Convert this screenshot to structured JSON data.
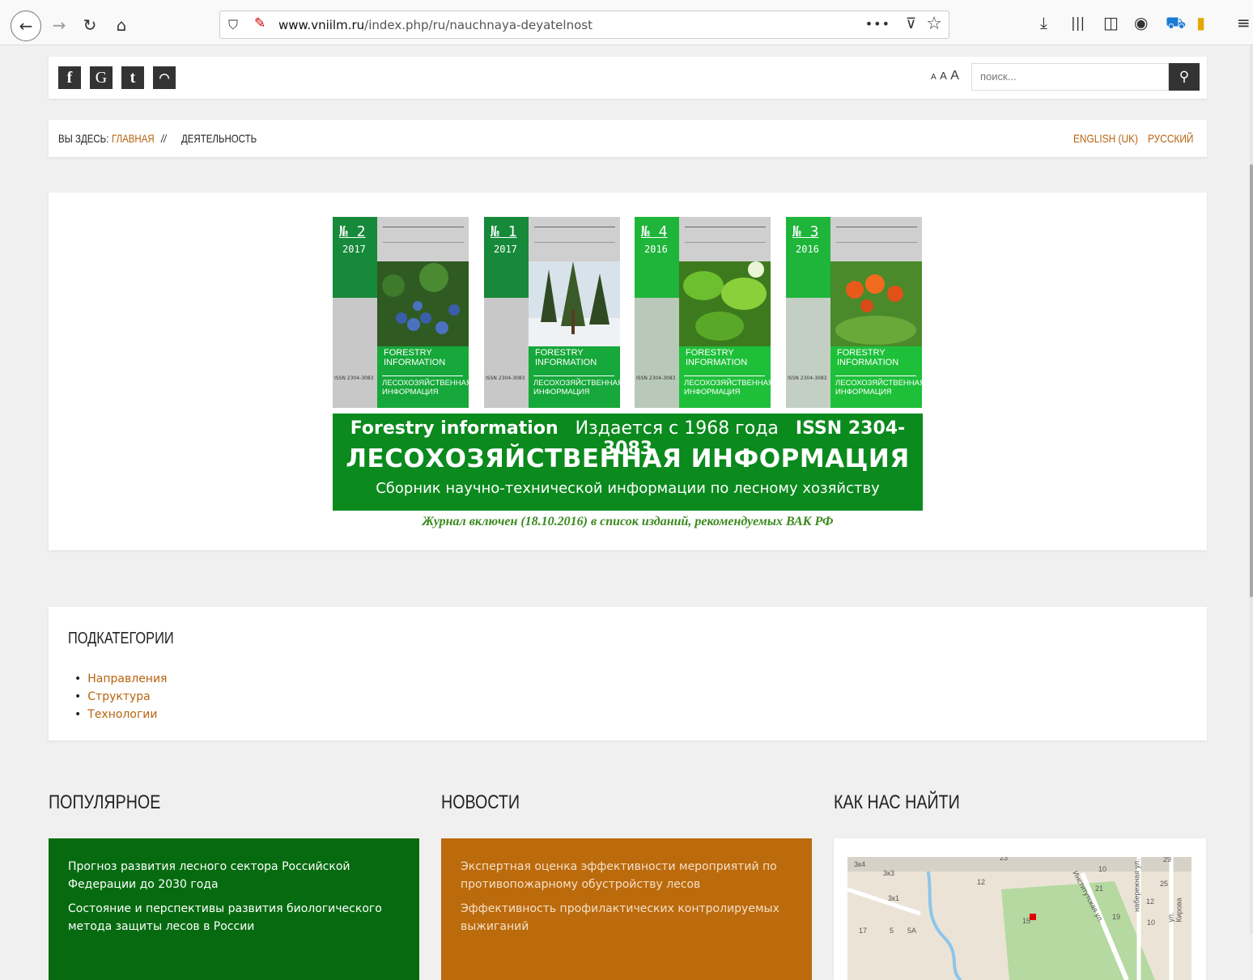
{
  "browser": {
    "url_host": "www.vniilm.ru",
    "url_path": "/index.php/ru/nauchnaya-deyatelnost",
    "menu_dots": "•••"
  },
  "topbar": {
    "social": [
      "f",
      "G",
      "t",
      "rss"
    ],
    "fontsize_small": "A",
    "fontsize_mid": "A",
    "fontsize_large": "A",
    "search_placeholder": "поиск..."
  },
  "breadcrumbs": {
    "label": "ВЫ ЗДЕСЬ:",
    "home": "ГЛАВНАЯ",
    "separator": "//",
    "current": "ДЕЯТЕЛЬНОСТЬ"
  },
  "languages": [
    "ENGLISH (UK)",
    "РУССКИЙ"
  ],
  "banner": {
    "covers": [
      {
        "number": "№ 2",
        "year": "2017"
      },
      {
        "number": "№ 1",
        "year": "2017"
      },
      {
        "number": "№ 4",
        "year": "2016"
      },
      {
        "number": "№ 3",
        "year": "2016"
      }
    ],
    "cover_title_en_1": "FORESTRY",
    "cover_title_en_2": "INFORMATION",
    "cover_title_ru_1": "ЛЕСОХОЗЯЙСТВЕННАЯ",
    "cover_title_ru_2": "ИНФОРМАЦИЯ",
    "cover_issn": "ISSN 2304-3083",
    "line1_en": "Forestry information",
    "line1_since": "Издается с 1968 года",
    "line1_issn": "ISSN 2304-3083",
    "line2": "ЛЕСОХОЗЯЙСТВЕННАЯ ИНФОРМАЦИЯ",
    "line3": "Сборник научно-технической информации по лесному хозяйству",
    "vak_note": "Журнал   включен (18.10.2016) в список изданий, рекомендуемых ВАК РФ"
  },
  "subcategories": {
    "title": "ПОДКАТЕГОРИИ",
    "items": [
      "Направления",
      "Структура",
      "Технологии"
    ]
  },
  "sections": {
    "popular_title": "ПОПУЛЯРНОЕ",
    "news_title": "НОВОСТИ",
    "find_title": "КАК НАС НАЙТИ"
  },
  "popular": [
    "Прогноз развития лесного сектора Российской Федерации до 2030 года",
    "Состояние и перспективы развития биологического метода защиты лесов в России"
  ],
  "news": [
    "Экспертная оценка эффективности мероприятий по противопожарному обустройству лесов",
    "Эффективность профилактических контролируемых выжиганий"
  ],
  "map_labels": [
    "3к4",
    "3к3",
    "3к1",
    "23",
    "12",
    "10",
    "21",
    "25",
    "29",
    "12",
    "19",
    "10",
    "15",
    "17",
    "5",
    "5А",
    "Институтская ул.",
    "набережная ул.",
    "ул. Кирова"
  ],
  "colors": {
    "accent": "#b8620e",
    "green_card": "#066b10",
    "orange_card": "#bb6a0c",
    "banner_green": "#0b8a1e"
  }
}
